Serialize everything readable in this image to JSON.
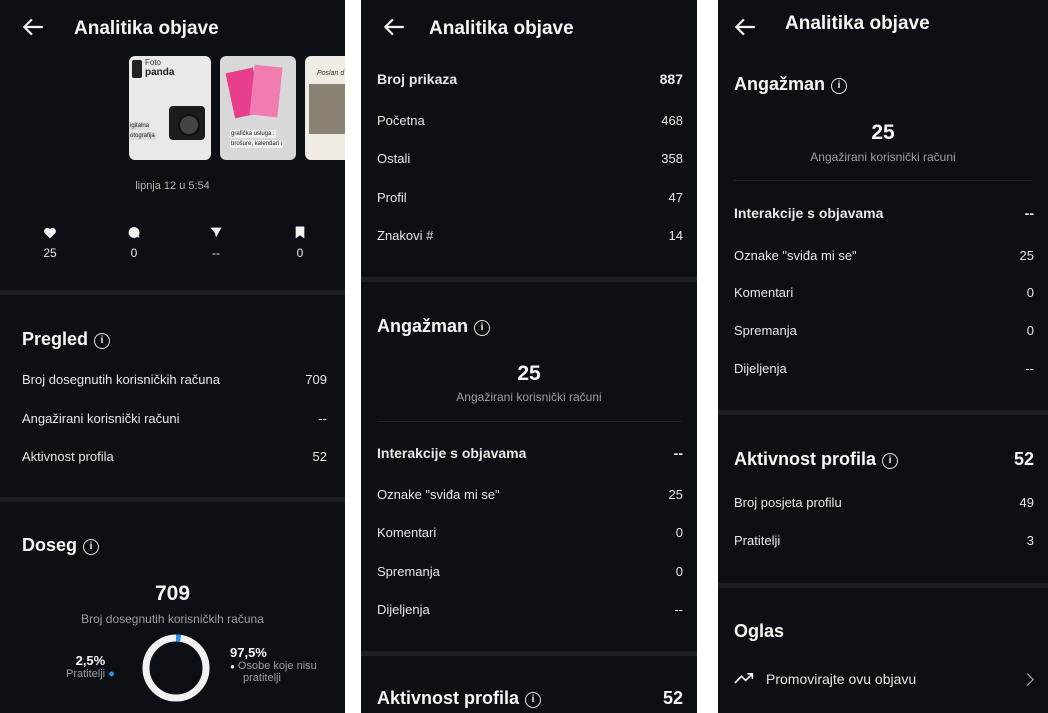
{
  "title": "Analitika objave",
  "post": {
    "thumb1": {
      "line1": "Foto",
      "line2": "panda",
      "line3": "igitalna",
      "line4": "otografija"
    },
    "thumb2": {
      "line1": "grafička usluga :",
      "line2": "brošure, kalendari i"
    },
    "thumb3": {
      "line1": "Poslan d"
    },
    "date": "lipnja 12 u 5:54"
  },
  "stats": {
    "likes": "25",
    "comments": "0",
    "shares": "--",
    "saves": "0"
  },
  "pregled": {
    "title": "Pregled",
    "rows": [
      {
        "label": "Broj dosegnutih korisničkih računa",
        "value": "709"
      },
      {
        "label": "Angažirani korisnički računi",
        "value": "--"
      },
      {
        "label": "Aktivnost profila",
        "value": "52"
      }
    ]
  },
  "doseg": {
    "title": "Doseg",
    "total": "709",
    "subtitle": "Broj dosegnutih korisničkih računa",
    "followers_pct": "2,5%",
    "followers_label": "Pratitelji",
    "non_followers_pct": "97,5%",
    "non_followers_label_1": "Osobe koje nisu",
    "non_followers_label_2": "pratitelji",
    "followers_fraction": 0.025
  },
  "prikazi": {
    "header": {
      "label": "Broj prikaza",
      "value": "887"
    },
    "rows": [
      {
        "label": "Početna",
        "value": "468"
      },
      {
        "label": "Ostali",
        "value": "358"
      },
      {
        "label": "Profil",
        "value": "47"
      },
      {
        "label": "Znakovi #",
        "value": "14"
      }
    ]
  },
  "angazman": {
    "title": "Angažman",
    "total": "25",
    "subtitle": "Angažirani korisnički računi",
    "interactions": {
      "label": "Interakcije s objavama",
      "value": "--"
    },
    "rows": [
      {
        "label": "Oznake \"sviđa mi se\"",
        "value": "25"
      },
      {
        "label": "Komentari",
        "value": "0"
      },
      {
        "label": "Spremanja",
        "value": "0"
      },
      {
        "label": "Dijeljenja",
        "value": "--"
      }
    ]
  },
  "aktivnost": {
    "title": "Aktivnost profila",
    "value": "52",
    "rows": [
      {
        "label": "Broj posjeta profilu",
        "value": "49"
      },
      {
        "label": "Pratitelji",
        "value": "3"
      }
    ]
  },
  "oglas": {
    "title": "Oglas",
    "promote_label": "Promovirajte ovu objavu"
  },
  "colors": {
    "background": "#0c0f14",
    "accent_blue": "#2b95e9",
    "separator": "#1c2026"
  }
}
